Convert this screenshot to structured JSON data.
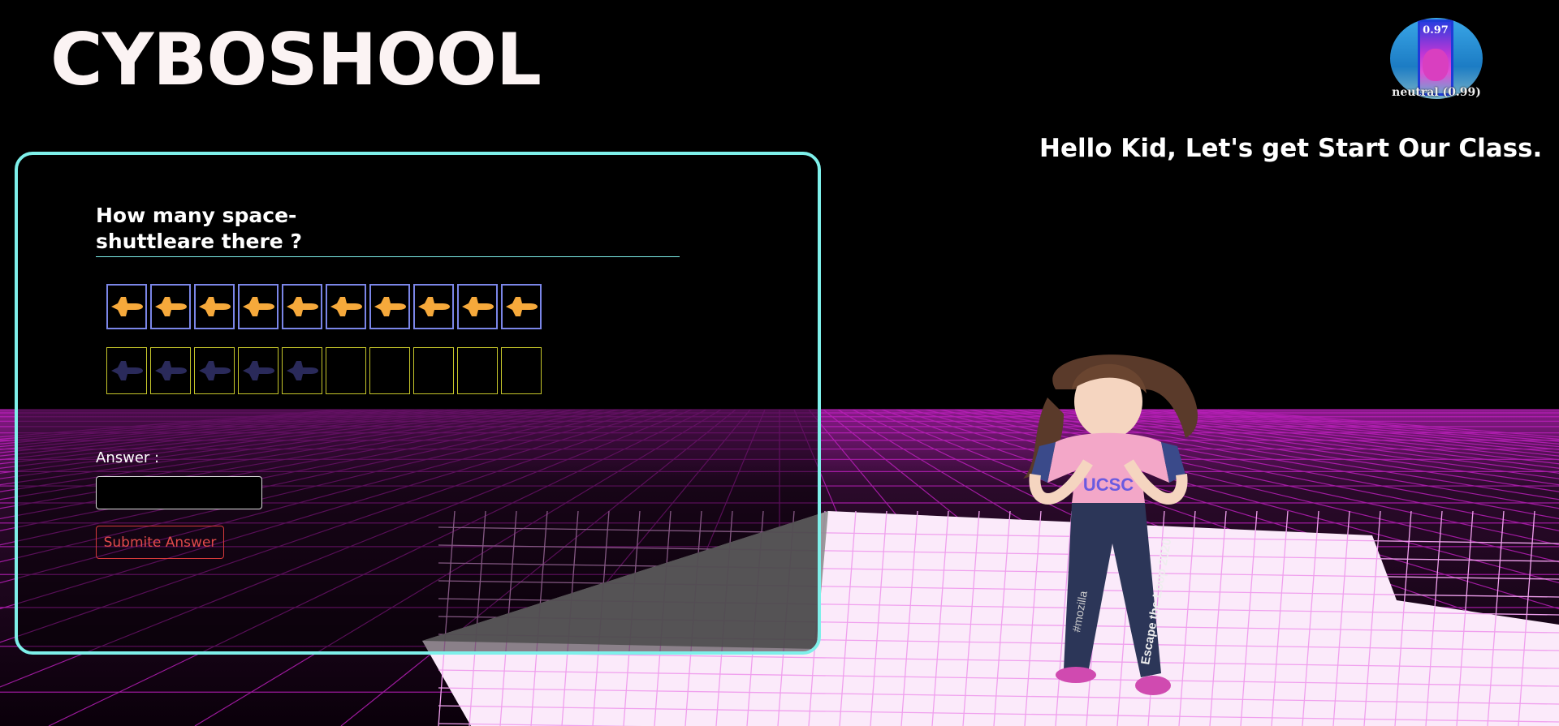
{
  "app": {
    "title": "CYBOSHOOL",
    "greeting": "Hello Kid, Let's get Start Our Class."
  },
  "emotion_widget": {
    "score": "0.97",
    "label": "neutral (0.99)"
  },
  "quiz": {
    "question": "How many space-shuttleare there ?",
    "shuttle_icon": "space-shuttle-icon",
    "top_row_filled": 10,
    "bottom_row_filled": 5,
    "row_size": 10,
    "answer_label": "Answer :",
    "answer_value": "",
    "submit_label": "Submite Answer"
  },
  "avatar": {
    "shirt_text": "UCSC",
    "pants_left_text": "#mozilla",
    "pants_right_text": "Escape the Loop 2020"
  },
  "colors": {
    "panel_border": "#7ef0ea",
    "grid": "#c020c0",
    "shuttle_filled": "#f6a93b",
    "shuttle_dim": "#2a2a5a",
    "submit": "#d63a3a"
  }
}
